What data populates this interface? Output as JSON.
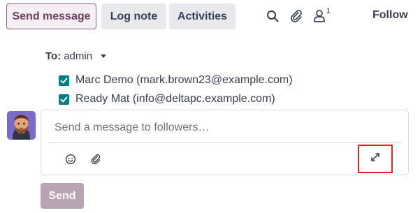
{
  "tabs": {
    "send_message": "Send message",
    "log_note": "Log note",
    "activities": "Activities"
  },
  "toolbar": {
    "search_icon": "search-icon",
    "attachment_icon": "paperclip-icon",
    "followers_icon": "user-icon",
    "followers_count": "1",
    "follow_label": "Follow"
  },
  "recipients": {
    "to_label": "To:",
    "to_value": "admin",
    "items": [
      {
        "label": "Marc Demo (mark.brown23@example.com)",
        "checked": true
      },
      {
        "label": "Ready Mat (info@deltapc.example.com)",
        "checked": true
      }
    ]
  },
  "composer": {
    "placeholder": "Send a message to followers…",
    "emoji_icon": "smiley-icon",
    "attach_icon": "paperclip-icon",
    "expand_icon": "expand-icon"
  },
  "send_button": "Send",
  "colors": {
    "accent": "#6b3f5f",
    "checkbox": "#017e84",
    "send_disabled": "#b8a4b3",
    "highlight": "#dc2626"
  }
}
